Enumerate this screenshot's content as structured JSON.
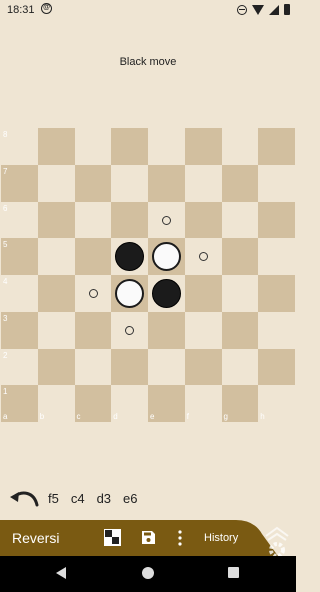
{
  "status_bar": {
    "time": "18:31",
    "at_icon": "@"
  },
  "turn_label": "Black move",
  "board": {
    "rank_labels": [
      "8",
      "7",
      "6",
      "5",
      "4",
      "3",
      "2",
      "1"
    ],
    "file_labels": [
      "a",
      "b",
      "c",
      "d",
      "e",
      "f",
      "g",
      "h"
    ],
    "pieces": [
      {
        "square": "d5",
        "color": "black"
      },
      {
        "square": "e5",
        "color": "white"
      },
      {
        "square": "d4",
        "color": "white"
      },
      {
        "square": "e4",
        "color": "black"
      }
    ],
    "hints": [
      "e6",
      "f5",
      "c4",
      "d3"
    ]
  },
  "history": {
    "moves": [
      "f5",
      "c4",
      "d3",
      "e6"
    ]
  },
  "toolbar": {
    "title": "Reversi",
    "history_label": "History"
  },
  "colors": {
    "light_square": "#efe5d3",
    "dark_square": "#d2bf9f",
    "toolbar": "#7a5a12",
    "background": "#efe5d3"
  }
}
